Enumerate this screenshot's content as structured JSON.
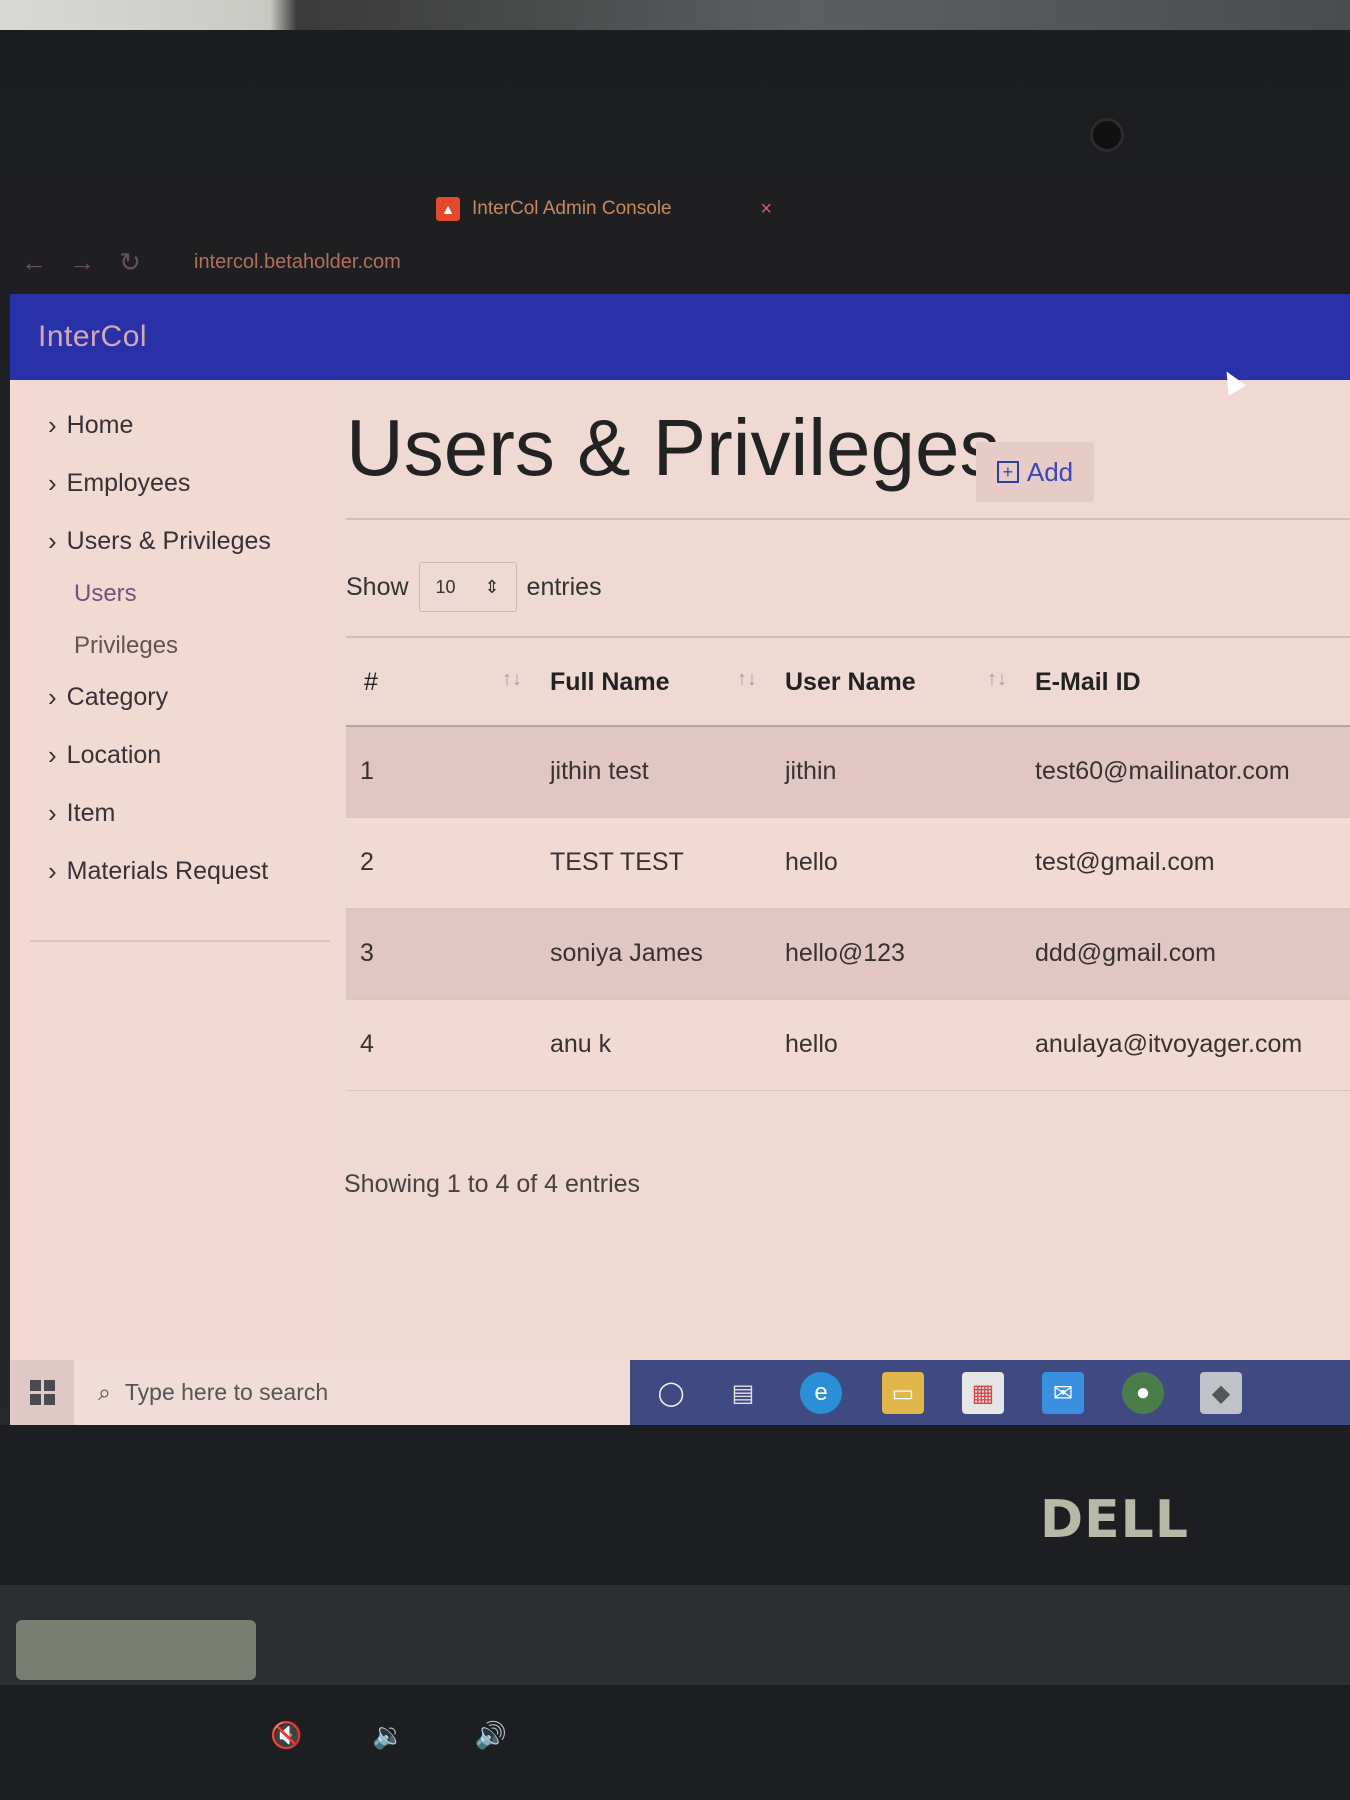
{
  "browser": {
    "tab_title": "InterCol Admin Console",
    "url": "intercol.betaholder.com"
  },
  "app": {
    "brand": "InterCol"
  },
  "sidebar": {
    "items": [
      {
        "label": "Home"
      },
      {
        "label": "Employees"
      },
      {
        "label": "Users & Privileges"
      },
      {
        "label": "Users"
      },
      {
        "label": "Privileges"
      },
      {
        "label": "Category"
      },
      {
        "label": "Location"
      },
      {
        "label": "Item"
      },
      {
        "label": "Materials Request"
      }
    ]
  },
  "main": {
    "title": "Users & Privileges",
    "add_label": "Add",
    "show_label": "Show",
    "page_size": "10",
    "entries_label": "entries",
    "columns": [
      "#",
      "Full Name",
      "User Name",
      "E-Mail ID"
    ],
    "rows": [
      {
        "num": "1",
        "full_name": "jithin test",
        "user_name": "jithin",
        "email": "test60@mailinator.com"
      },
      {
        "num": "2",
        "full_name": "TEST TEST",
        "user_name": "hello",
        "email": "test@gmail.com"
      },
      {
        "num": "3",
        "full_name": "soniya James",
        "user_name": "hello@123",
        "email": "ddd@gmail.com"
      },
      {
        "num": "4",
        "full_name": "anu k",
        "user_name": "hello",
        "email": "anulaya@itvoyager.com"
      }
    ],
    "info": "Showing 1 to 4 of 4 entries"
  },
  "taskbar": {
    "search_placeholder": "Type here to search"
  },
  "laptop": {
    "brand": "DELL"
  },
  "colors": {
    "header": "#2831a8",
    "accent": "#3a48b8"
  }
}
